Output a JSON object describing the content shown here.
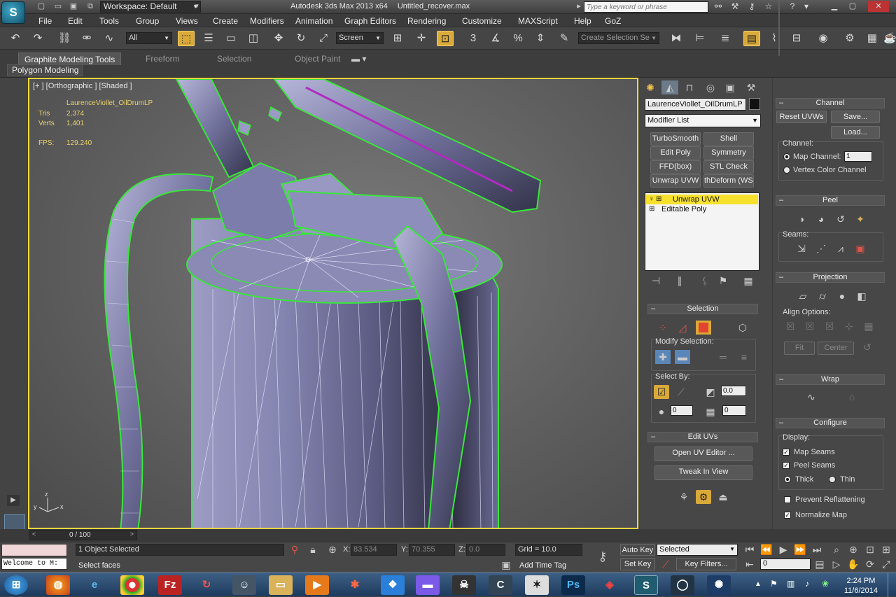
{
  "titlebar": {
    "logo": "S",
    "workspace_label": "Workspace: Default",
    "app_name": "Autodesk 3ds Max  2013 x64",
    "file_name": "Untitled_recover.max",
    "search_placeholder": "Type a keyword or phrase"
  },
  "menu": [
    "File",
    "Edit",
    "Tools",
    "Group",
    "Views",
    "Create",
    "Modifiers",
    "Animation",
    "Graph Editors",
    "Rendering",
    "Customize",
    "MAXScript",
    "Help",
    "GoZ"
  ],
  "toolbar": {
    "selection_filter": "All",
    "ref_coord": "Screen",
    "named_selection_placeholder": "Create Selection Se"
  },
  "ribbon": {
    "tabs": [
      "Graphite Modeling Tools",
      "Freeform",
      "Selection",
      "Object Paint"
    ],
    "subtab": "Polygon Modeling"
  },
  "viewport": {
    "label": "[+ ] [Orthographic ] [Shaded ]",
    "object_name": "LaurenceViollet_OilDrumLP",
    "tris_label": "Tris",
    "tris_value": "2,374",
    "verts_label": "Verts",
    "verts_value": "1,401",
    "fps_label": "FPS:",
    "fps_value": "129.240"
  },
  "command_panel": {
    "object_name": "LaurenceViollet_OilDrumLP",
    "object_color": "#111111",
    "modifier_list": "Modifier List",
    "modifier_buttons": [
      "TurboSmooth",
      "Shell",
      "Edit Poly",
      "Symmetry",
      "FFD(box)",
      "STL Check",
      "Unwrap UVW",
      "thDeform (WSI"
    ],
    "stack": [
      "Unwrap UVW",
      "Editable Poly"
    ],
    "selection": {
      "title": "Selection",
      "modify_selection": "Modify Selection:",
      "select_by": "Select By:",
      "angle_value": "0.0",
      "spin1": "0",
      "spin2": "0"
    },
    "edit_uvs": {
      "title": "Edit UVs",
      "open_editor": "Open UV Editor ...",
      "tweak": "Tweak In View"
    }
  },
  "rollout": {
    "channel": {
      "title": "Channel",
      "reset": "Reset UVWs",
      "save": "Save...",
      "load": "Load...",
      "channel_label": "Channel:",
      "map_channel": "Map Channel:",
      "map_channel_value": "1",
      "vertex_color": "Vertex Color Channel"
    },
    "peel": {
      "title": "Peel",
      "seams": "Seams:"
    },
    "projection": {
      "title": "Projection",
      "align_options": "Align Options:",
      "fit": "Fit",
      "center": "Center"
    },
    "wrap": {
      "title": "Wrap"
    },
    "configure": {
      "title": "Configure",
      "display": "Display:",
      "map_seams": "Map Seams",
      "peel_seams": "Peel Seams",
      "thick": "Thick",
      "thin": "Thin",
      "prevent": "Prevent Reflattening",
      "normalize": "Normalize Map"
    }
  },
  "timeline": {
    "frame": "0 / 100"
  },
  "status": {
    "selected": "1 Object Selected",
    "prompt": "Select faces",
    "welcome": "Welcome to M:",
    "x_label": "X:",
    "x_value": "83.534",
    "y_label": "Y:",
    "y_value": "70.355",
    "z_label": "Z:",
    "z_value": "0.0",
    "grid": "Grid = 10.0",
    "add_time_tag": "Add Time Tag",
    "auto_key": "Auto Key",
    "set_key": "Set Key",
    "key_mode": "Selected",
    "key_filters": "Key Filters...",
    "frame_value": "0"
  },
  "taskbar": {
    "time": "2:24 PM",
    "date": "11/6/2014"
  },
  "colors": {
    "accent": "#f5d742",
    "wire": "#39e63a",
    "active_button": "#d9a93a"
  }
}
